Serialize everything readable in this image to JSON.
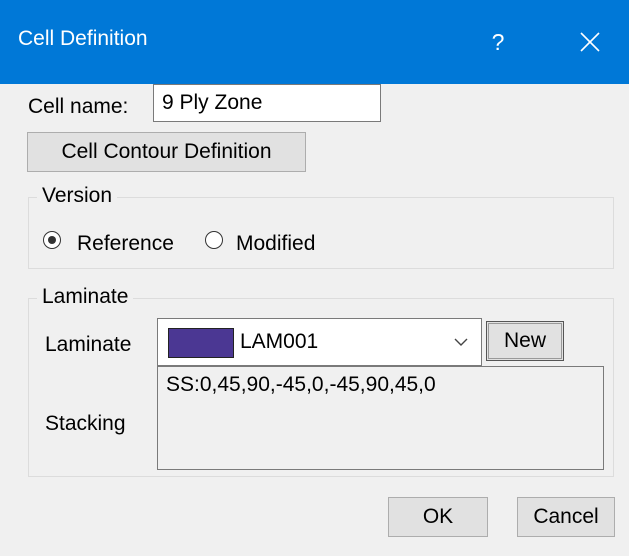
{
  "window": {
    "title": "Cell Definition",
    "help_glyph": "?",
    "accent_color": "#0078d7"
  },
  "cell": {
    "name_label": "Cell name:",
    "name_value": "9 Ply Zone",
    "contour_button_label": "Cell Contour Definition"
  },
  "version": {
    "group_label": "Version",
    "options": [
      {
        "label": "Reference",
        "selected": true
      },
      {
        "label": "Modified",
        "selected": false
      }
    ]
  },
  "laminate": {
    "group_label": "Laminate",
    "field_label": "Laminate",
    "selected_value": "LAM001",
    "swatch_color": "#4b3793",
    "new_button_label": "New",
    "stacking_label": "Stacking",
    "stacking_value": "SS:0,45,90,-45,0,-45,90,45,0"
  },
  "footer": {
    "ok_label": "OK",
    "cancel_label": "Cancel"
  }
}
